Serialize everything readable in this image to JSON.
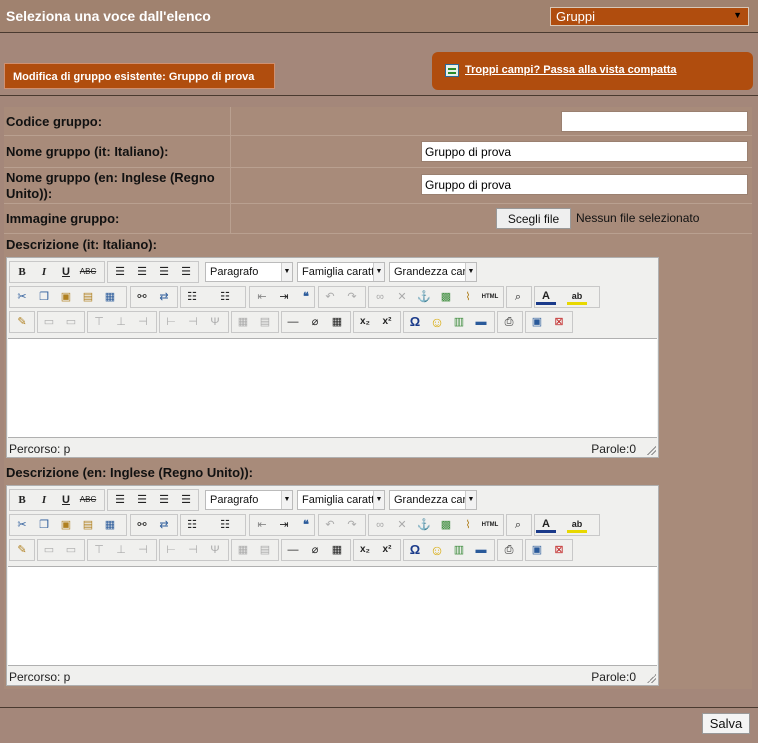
{
  "header": {
    "title": "Seleziona una voce dall'elenco",
    "select_value": "Gruppi"
  },
  "tabs": {
    "edit_label": "Modifica di gruppo esistente: Gruppo di prova",
    "compact_link": "Troppi campi? Passa alla vista compatta"
  },
  "form": {
    "code_label": "Codice gruppo:",
    "code_value": "",
    "name_it_label": "Nome gruppo (it: Italiano):",
    "name_it_value": "Gruppo di prova",
    "name_en_label": "Nome gruppo (en: Inglese (Regno Unito)):",
    "name_en_value": "Gruppo di prova",
    "image_label": "Immagine gruppo:",
    "file_button": "Scegli file",
    "file_status": "Nessun file selezionato",
    "desc_it_label": "Descrizione (it: Italiano):",
    "desc_en_label": "Descrizione (en: Inglese (Regno Unito)):"
  },
  "editor": {
    "format_combo": "Paragrafo",
    "font_combo": "Famiglia caratt",
    "size_combo": "Grandezza car",
    "path_label": "Percorso: p",
    "word_count": "Parole:0"
  },
  "footer": {
    "save_label": "Salva"
  },
  "icons": {
    "row1": [
      "bold-icon",
      "italic-icon",
      "underline-icon",
      "strikethrough-icon",
      "align-left-icon",
      "align-center-icon",
      "align-right-icon",
      "align-justify-icon"
    ],
    "row2": [
      "cut-icon",
      "copy-icon",
      "paste-icon",
      "paste-text-icon",
      "paste-word-icon",
      "find-icon",
      "replace-icon",
      "bullet-list-icon",
      "numbered-list-icon",
      "outdent-icon",
      "indent-icon",
      "blockquote-icon",
      "undo-icon",
      "redo-icon",
      "link-icon",
      "unlink-icon",
      "anchor-icon",
      "image-icon",
      "cleanup-icon",
      "html-icon",
      "preview-icon",
      "text-color-icon",
      "highlight-icon"
    ],
    "row3": [
      "edit-icon",
      "table-icon",
      "horizontal-rule-icon",
      "remove-format-icon",
      "visual-aid-icon",
      "subscript-icon",
      "superscript-icon",
      "special-char-icon",
      "emoticon-icon",
      "media-icon",
      "hr-icon",
      "print-icon",
      "fullscreen-icon",
      "paste-word-icon-2"
    ]
  }
}
